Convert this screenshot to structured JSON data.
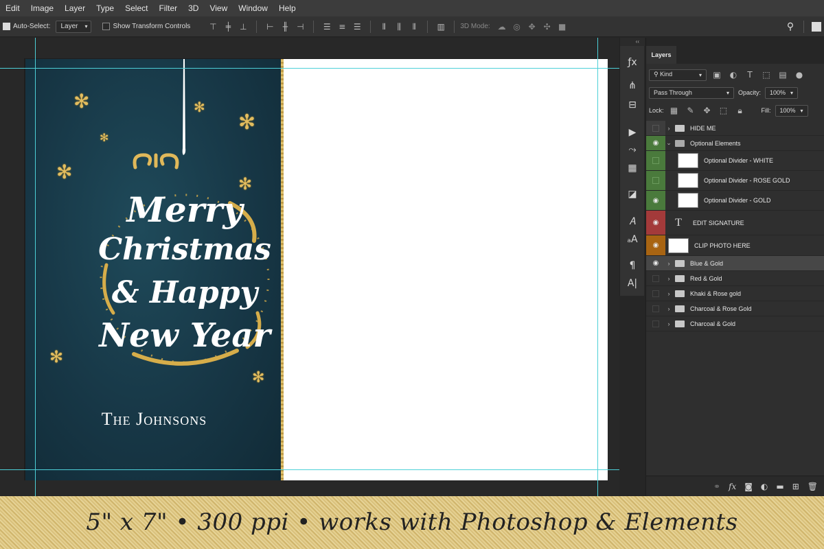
{
  "menu": [
    "Edit",
    "Image",
    "Layer",
    "Type",
    "Select",
    "Filter",
    "3D",
    "View",
    "Window",
    "Help"
  ],
  "options_bar": {
    "auto_select_label": "Auto-Select:",
    "auto_select_value": "Layer",
    "transform_label": "Show Transform Controls",
    "mode_3d_label": "3D Mode:"
  },
  "card": {
    "greeting_lines": [
      "Merry",
      "Christmas",
      "& Happy",
      "New Year"
    ],
    "family_name": "The Johnsons"
  },
  "layers_panel": {
    "tab_label": "Layers",
    "kind_label": "Kind",
    "blend_mode": "Pass Through",
    "opacity_label": "Opacity:",
    "opacity_value": "100%",
    "lock_label": "Lock:",
    "fill_label": "Fill:",
    "fill_value": "100%",
    "layers": [
      {
        "name": "HIDE ME",
        "type": "group",
        "visible": false,
        "tag_color": "#3a3a3a"
      },
      {
        "name": "Optional Elements",
        "type": "group",
        "visible": true,
        "tag_color": "#4a7a3c",
        "expanded": true
      },
      {
        "name": "Optional Divider - WHITE",
        "type": "smart",
        "visible": false,
        "tag_color": "#4a7a3c"
      },
      {
        "name": "Optional Divider - ROSE GOLD",
        "type": "image",
        "visible": false,
        "tag_color": "#4a7a3c"
      },
      {
        "name": "Optional Divider - GOLD",
        "type": "image",
        "visible": true,
        "tag_color": "#4a7a3c"
      },
      {
        "name": "EDIT SIGNATURE",
        "type": "text",
        "visible": true,
        "tag_color": "#a33a3a"
      },
      {
        "name": "CLIP PHOTO HERE",
        "type": "smart",
        "visible": true,
        "tag_color": "#a86412"
      },
      {
        "name": "Blue & Gold",
        "type": "group",
        "visible": true,
        "tag_color": "#3a3a3a",
        "selected": true
      },
      {
        "name": "Red & Gold",
        "type": "group",
        "visible": false,
        "tag_color": "#2f2f2f"
      },
      {
        "name": "Khaki & Rose gold",
        "type": "group",
        "visible": false,
        "tag_color": "#2f2f2f"
      },
      {
        "name": "Charcoal & Rose Gold",
        "type": "group",
        "visible": false,
        "tag_color": "#2f2f2f"
      },
      {
        "name": "Charcoal & Gold",
        "type": "group",
        "visible": false,
        "tag_color": "#2f2f2f"
      }
    ]
  },
  "banner_text": "5\" x 7\"  •  300 ppi  • works with Photoshop  & Elements"
}
